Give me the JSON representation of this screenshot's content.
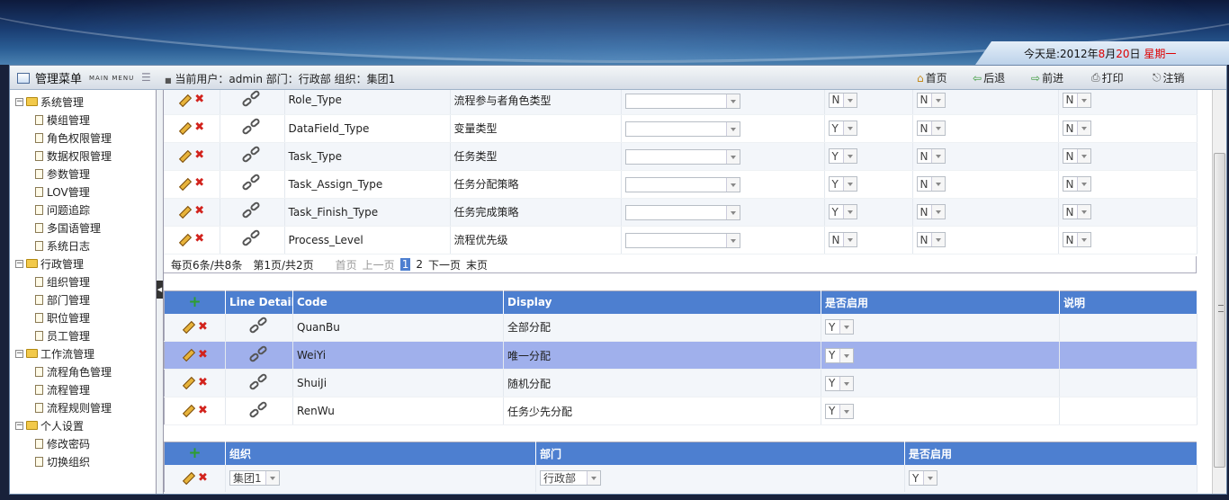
{
  "header": {
    "date_prefix": "今天是:2012年",
    "month": "8",
    "month_unit": "月",
    "day": "20",
    "day_unit": "日",
    "weekday": "星期一"
  },
  "menubar": {
    "menu_title": "管理菜单",
    "menu_subtitle": "MAIN MENU",
    "current_user": "当前用户：admin 部门：行政部 组织：集团1",
    "buttons": [
      "首页",
      "后退",
      "前进",
      "打印",
      "注销"
    ]
  },
  "tree": [
    {
      "label": "系统管理",
      "type": "folder",
      "level": 0
    },
    {
      "label": "模组管理",
      "type": "doc",
      "level": 1
    },
    {
      "label": "角色权限管理",
      "type": "doc",
      "level": 1
    },
    {
      "label": "数据权限管理",
      "type": "doc",
      "level": 1
    },
    {
      "label": "参数管理",
      "type": "doc",
      "level": 1
    },
    {
      "label": "LOV管理",
      "type": "doc",
      "level": 1
    },
    {
      "label": "问题追踪",
      "type": "doc",
      "level": 1
    },
    {
      "label": "多国语管理",
      "type": "doc",
      "level": 1
    },
    {
      "label": "系统日志",
      "type": "doc",
      "level": 1
    },
    {
      "label": "行政管理",
      "type": "folder",
      "level": 0
    },
    {
      "label": "组织管理",
      "type": "doc",
      "level": 1
    },
    {
      "label": "部门管理",
      "type": "doc",
      "level": 1
    },
    {
      "label": "职位管理",
      "type": "doc",
      "level": 1
    },
    {
      "label": "员工管理",
      "type": "doc",
      "level": 1
    },
    {
      "label": "工作流管理",
      "type": "folder",
      "level": 0
    },
    {
      "label": "流程角色管理",
      "type": "doc",
      "level": 1
    },
    {
      "label": "流程管理",
      "type": "doc",
      "level": 1
    },
    {
      "label": "流程规则管理",
      "type": "doc",
      "level": 1
    },
    {
      "label": "个人设置",
      "type": "folder",
      "level": 0
    },
    {
      "label": "修改密码",
      "type": "doc",
      "level": 1
    },
    {
      "label": "切换组织",
      "type": "doc",
      "level": 1
    }
  ],
  "lov_table": {
    "rows": [
      {
        "code": "Role_Type",
        "display": "流程参与者角色类型",
        "a": "N",
        "b": "N",
        "c": "N"
      },
      {
        "code": "DataField_Type",
        "display": "变量类型",
        "a": "Y",
        "b": "N",
        "c": "N"
      },
      {
        "code": "Task_Type",
        "display": "任务类型",
        "a": "Y",
        "b": "N",
        "c": "N"
      },
      {
        "code": "Task_Assign_Type",
        "display": "任务分配策略",
        "a": "Y",
        "b": "N",
        "c": "N"
      },
      {
        "code": "Task_Finish_Type",
        "display": "任务完成策略",
        "a": "Y",
        "b": "N",
        "c": "N"
      },
      {
        "code": "Process_Level",
        "display": "流程优先级",
        "a": "N",
        "b": "N",
        "c": "N"
      }
    ],
    "pager": {
      "summary": "每页6条/共8条",
      "page_info": "第1页/共2页",
      "first": "首页",
      "prev": "上一页",
      "current": "1",
      "next_num": "2",
      "next": "下一页",
      "last": "末页"
    }
  },
  "line_table": {
    "headers": [
      "Line Detail",
      "Code",
      "Display",
      "是否启用",
      "说明"
    ],
    "rows": [
      {
        "code": "QuanBu",
        "display": "全部分配",
        "enabled": "Y"
      },
      {
        "code": "WeiYi",
        "display": "唯一分配",
        "enabled": "Y"
      },
      {
        "code": "ShuiJi",
        "display": "随机分配",
        "enabled": "Y"
      },
      {
        "code": "RenWu",
        "display": "任务少先分配",
        "enabled": "Y"
      }
    ]
  },
  "org_table": {
    "headers": [
      "组织",
      "部门",
      "是否启用"
    ],
    "rows": [
      {
        "org": "集团1",
        "dept": "行政部",
        "enabled": "Y"
      }
    ]
  }
}
